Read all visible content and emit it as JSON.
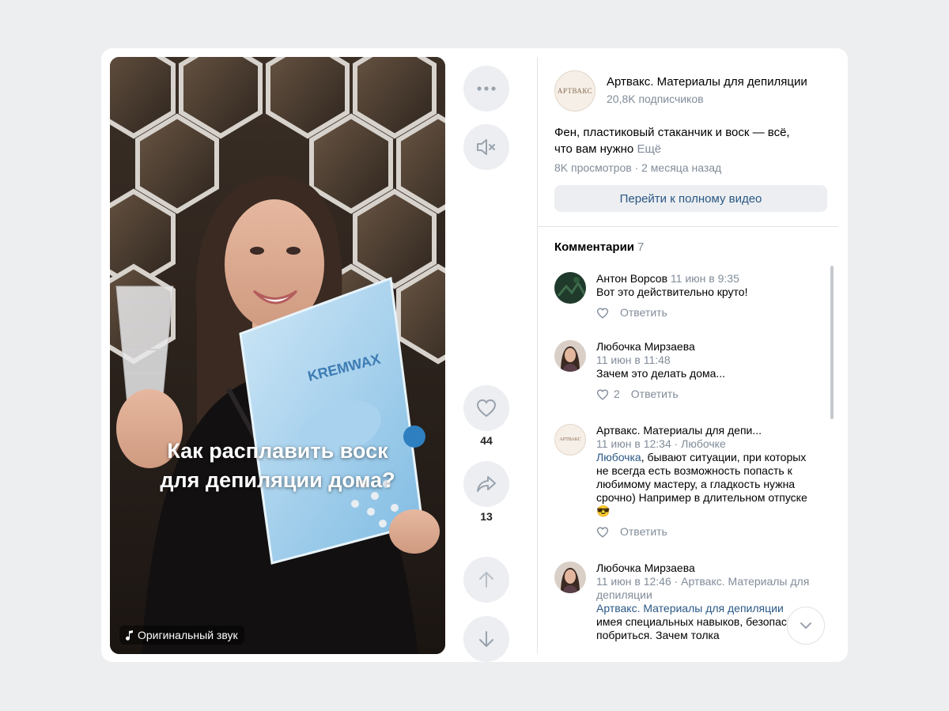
{
  "video": {
    "caption_line1": "Как расплавить воск",
    "caption_line2": "для депиляции дома?",
    "sound_label": "Оригинальный звук",
    "package_brand": "KREMWAX"
  },
  "actions": {
    "more_icon": "more-icon",
    "mute_icon": "muted-speaker-icon",
    "like_count": "44",
    "share_count": "13"
  },
  "channel": {
    "avatar_text": "АРТВАКС",
    "name": "Артвакс. Материалы для депиляции",
    "subscribers": "20,8K подписчиков"
  },
  "description": {
    "line1": "Фен, пластиковый стаканчик и воск — всё,",
    "line2": "что вам нужно",
    "more": "Ещё"
  },
  "meta": "8K просмотров · 2 месяца назад",
  "full_video_button": "Перейти к полному видео",
  "comments": {
    "title": "Комментарии",
    "count": "7",
    "items": [
      {
        "author": "Антон Ворсов",
        "date": "11 июн в 9:35",
        "text": "Вот это действительно круто!",
        "likes": "",
        "reply_label": "Ответить"
      },
      {
        "author": "Любочка Мирзаева",
        "date": "11 июн в 11:48",
        "text": "Зачем это делать дома...",
        "likes": "2",
        "reply_label": "Ответить"
      },
      {
        "author": "Артвакс. Материалы для депи...",
        "date": "11 июн в 12:34",
        "reply_to": "· Любочке",
        "mention": "Любочка",
        "text": ", бывают ситуации, при которых не всегда есть возможность попасть к любимому мастеру, а гладкость нужна срочно) Например в длительном отпуске 😎",
        "likes": "",
        "reply_label": "Ответить"
      },
      {
        "author": "Любочка Мирзаева",
        "date": "11 июн в 12:46",
        "reply_to": "· Артвакс. Материалы для депиляции",
        "mention": "Артвакс. Материалы для депиляции",
        "text": "имея специальных навыков, безопаснее побриться. Зачем толка",
        "likes": "",
        "reply_label": "Ответить"
      }
    ]
  },
  "colors": {
    "link": "#2a5885",
    "secondary": "#818c99",
    "button_bg": "#eceef1"
  }
}
